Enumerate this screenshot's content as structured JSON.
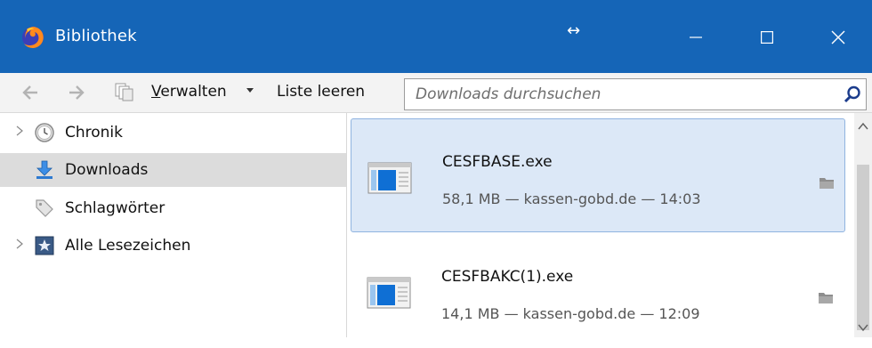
{
  "window": {
    "title": "Bibliothek",
    "title_bar_color": "#1565b7"
  },
  "toolbar": {
    "manage_first": "V",
    "manage_rest": "erwalten",
    "clear_label": "Liste leeren"
  },
  "search": {
    "placeholder": "Downloads durchsuchen"
  },
  "sidebar": {
    "items": [
      {
        "label": "Chronik",
        "icon": "clock-icon",
        "expandable": true,
        "selected": false
      },
      {
        "label": "Downloads",
        "icon": "download-arrow-icon",
        "expandable": false,
        "selected": true
      },
      {
        "label": "Schlagwörter",
        "icon": "tag-icon",
        "expandable": false,
        "selected": false
      },
      {
        "label": "Alle Lesezeichen",
        "icon": "star-bookmark-icon",
        "expandable": true,
        "selected": false
      }
    ]
  },
  "downloads": [
    {
      "name": "CESFBASE.exe",
      "meta": "58,1 MB — kassen-gobd.de — 14:03",
      "selected": true
    },
    {
      "name": "CESFBAKC(1).exe",
      "meta": "14,1 MB — kassen-gobd.de — 12:09",
      "selected": false
    }
  ],
  "colors": {
    "selection_bg": "#dce8f7",
    "sidebar_selection_bg": "#dcdcdc"
  }
}
